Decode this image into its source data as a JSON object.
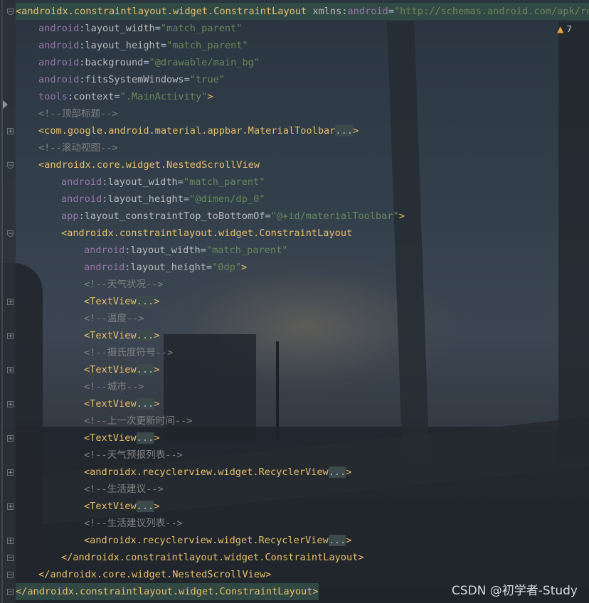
{
  "editor": {
    "warning_count": "7",
    "watermark": "CSDN @初学者-Study",
    "lines": [
      {
        "indent": 0,
        "hl": true,
        "fold": "open",
        "segs": [
          [
            "tag",
            "<androidx.constraintlayout.widget.ConstraintLayout"
          ],
          [
            "plain",
            " "
          ],
          [
            "attr",
            "xmlns:"
          ],
          [
            "attrns",
            "android"
          ],
          [
            "eq",
            "="
          ],
          [
            "val",
            "\"http://schemas.android.com/apk/res/"
          ]
        ]
      },
      {
        "indent": 1,
        "segs": [
          [
            "attrns",
            "android"
          ],
          [
            "eq",
            ":"
          ],
          [
            "attr",
            "layout_width"
          ],
          [
            "eq",
            "="
          ],
          [
            "val",
            "\"match_parent\""
          ]
        ]
      },
      {
        "indent": 1,
        "segs": [
          [
            "attrns",
            "android"
          ],
          [
            "eq",
            ":"
          ],
          [
            "attr",
            "layout_height"
          ],
          [
            "eq",
            "="
          ],
          [
            "val",
            "\"match_parent\""
          ]
        ]
      },
      {
        "indent": 1,
        "segs": [
          [
            "attrns",
            "android"
          ],
          [
            "eq",
            ":"
          ],
          [
            "attr",
            "background"
          ],
          [
            "eq",
            "="
          ],
          [
            "val",
            "\"@drawable/main_bg\""
          ]
        ]
      },
      {
        "indent": 1,
        "segs": [
          [
            "attrns",
            "android"
          ],
          [
            "eq",
            ":"
          ],
          [
            "attr",
            "fitsSystemWindows"
          ],
          [
            "eq",
            "="
          ],
          [
            "val",
            "\"true\""
          ]
        ]
      },
      {
        "indent": 1,
        "segs": [
          [
            "attrns",
            "tools"
          ],
          [
            "eq",
            ":"
          ],
          [
            "attr",
            "context"
          ],
          [
            "eq",
            "="
          ],
          [
            "val",
            "\".MainActivity\""
          ],
          [
            "tag",
            ">"
          ]
        ]
      },
      {
        "indent": 1,
        "segs": [
          [
            "cmt",
            "<!--顶部标题-->"
          ]
        ]
      },
      {
        "indent": 1,
        "fold": "closed",
        "segs": [
          [
            "tag",
            "<com.google.android.material.appbar.MaterialToolbar"
          ],
          [
            "fb",
            "..."
          ],
          [
            "tag",
            ">"
          ]
        ]
      },
      {
        "indent": 1,
        "segs": [
          [
            "cmt",
            "<!--滚动视图-->"
          ]
        ]
      },
      {
        "indent": 1,
        "fold": "open",
        "segs": [
          [
            "tag",
            "<androidx.core.widget.NestedScrollView"
          ]
        ]
      },
      {
        "indent": 2,
        "segs": [
          [
            "attrns",
            "android"
          ],
          [
            "eq",
            ":"
          ],
          [
            "attr",
            "layout_width"
          ],
          [
            "eq",
            "="
          ],
          [
            "val",
            "\"match_parent\""
          ]
        ]
      },
      {
        "indent": 2,
        "segs": [
          [
            "attrns",
            "android"
          ],
          [
            "eq",
            ":"
          ],
          [
            "attr",
            "layout_height"
          ],
          [
            "eq",
            "="
          ],
          [
            "val",
            "\"@dimen/dp_0\""
          ]
        ]
      },
      {
        "indent": 2,
        "segs": [
          [
            "attrns",
            "app"
          ],
          [
            "eq",
            ":"
          ],
          [
            "attr",
            "layout_constraintTop_toBottomOf"
          ],
          [
            "eq",
            "="
          ],
          [
            "val",
            "\"@+id/materialToolbar\""
          ],
          [
            "tag",
            ">"
          ]
        ]
      },
      {
        "indent": 2,
        "fold": "open",
        "segs": [
          [
            "tag",
            "<androidx.constraintlayout.widget.ConstraintLayout"
          ]
        ]
      },
      {
        "indent": 3,
        "segs": [
          [
            "attrns",
            "android"
          ],
          [
            "eq",
            ":"
          ],
          [
            "attr",
            "layout_width"
          ],
          [
            "eq",
            "="
          ],
          [
            "val",
            "\"match_parent\""
          ]
        ]
      },
      {
        "indent": 3,
        "segs": [
          [
            "attrns",
            "android"
          ],
          [
            "eq",
            ":"
          ],
          [
            "attr",
            "layout_height"
          ],
          [
            "eq",
            "="
          ],
          [
            "val",
            "\"0dp\""
          ],
          [
            "tag",
            ">"
          ]
        ]
      },
      {
        "indent": 3,
        "segs": [
          [
            "cmt",
            "<!--天气状况-->"
          ]
        ]
      },
      {
        "indent": 3,
        "fold": "closed",
        "segs": [
          [
            "tag",
            "<TextView"
          ],
          [
            "fb",
            "..."
          ],
          [
            "tag",
            ">"
          ]
        ]
      },
      {
        "indent": 3,
        "segs": [
          [
            "cmt",
            "<!--温度-->"
          ]
        ]
      },
      {
        "indent": 3,
        "fold": "closed",
        "segs": [
          [
            "tag",
            "<TextView"
          ],
          [
            "fb",
            "..."
          ],
          [
            "tag",
            ">"
          ]
        ]
      },
      {
        "indent": 3,
        "segs": [
          [
            "cmt",
            "<!--摄氏度符号-->"
          ]
        ]
      },
      {
        "indent": 3,
        "fold": "closed",
        "segs": [
          [
            "tag",
            "<TextView"
          ],
          [
            "fb",
            "..."
          ],
          [
            "tag",
            ">"
          ]
        ]
      },
      {
        "indent": 3,
        "segs": [
          [
            "cmt",
            "<!--城市-->"
          ]
        ]
      },
      {
        "indent": 3,
        "fold": "closed",
        "segs": [
          [
            "tag",
            "<TextView"
          ],
          [
            "fb",
            "..."
          ],
          [
            "tag",
            ">"
          ]
        ]
      },
      {
        "indent": 3,
        "segs": [
          [
            "cmt",
            "<!--上一次更新时间-->"
          ]
        ]
      },
      {
        "indent": 3,
        "fold": "closed",
        "segs": [
          [
            "tag",
            "<TextView"
          ],
          [
            "fb",
            "..."
          ],
          [
            "tag",
            ">"
          ]
        ]
      },
      {
        "indent": 3,
        "segs": [
          [
            "cmt",
            "<!--天气预报列表-->"
          ]
        ]
      },
      {
        "indent": 3,
        "fold": "closed",
        "segs": [
          [
            "tag",
            "<androidx.recyclerview.widget.RecyclerView"
          ],
          [
            "fb",
            "..."
          ],
          [
            "tag",
            ">"
          ]
        ]
      },
      {
        "indent": 3,
        "segs": [
          [
            "cmt",
            "<!--生活建议-->"
          ]
        ]
      },
      {
        "indent": 3,
        "fold": "closed",
        "segs": [
          [
            "tag",
            "<TextView"
          ],
          [
            "fb",
            "..."
          ],
          [
            "tag",
            ">"
          ]
        ]
      },
      {
        "indent": 3,
        "segs": [
          [
            "cmt",
            "<!--生活建议列表-->"
          ]
        ]
      },
      {
        "indent": 3,
        "fold": "closed",
        "segs": [
          [
            "tag",
            "<androidx.recyclerview.widget.RecyclerView"
          ],
          [
            "fb",
            "..."
          ],
          [
            "tag",
            ">"
          ]
        ]
      },
      {
        "indent": 2,
        "fold": "end",
        "segs": [
          [
            "tag",
            "</androidx.constraintlayout.widget.ConstraintLayout>"
          ]
        ]
      },
      {
        "indent": 1,
        "fold": "end",
        "segs": [
          [
            "tag",
            "</androidx.core.widget.NestedScrollView>"
          ]
        ]
      },
      {
        "indent": 0,
        "hl": true,
        "fold": "end",
        "segs": [
          [
            "tag",
            "</androidx.constraintlayout.widget.ConstraintLayout>"
          ]
        ]
      }
    ]
  }
}
